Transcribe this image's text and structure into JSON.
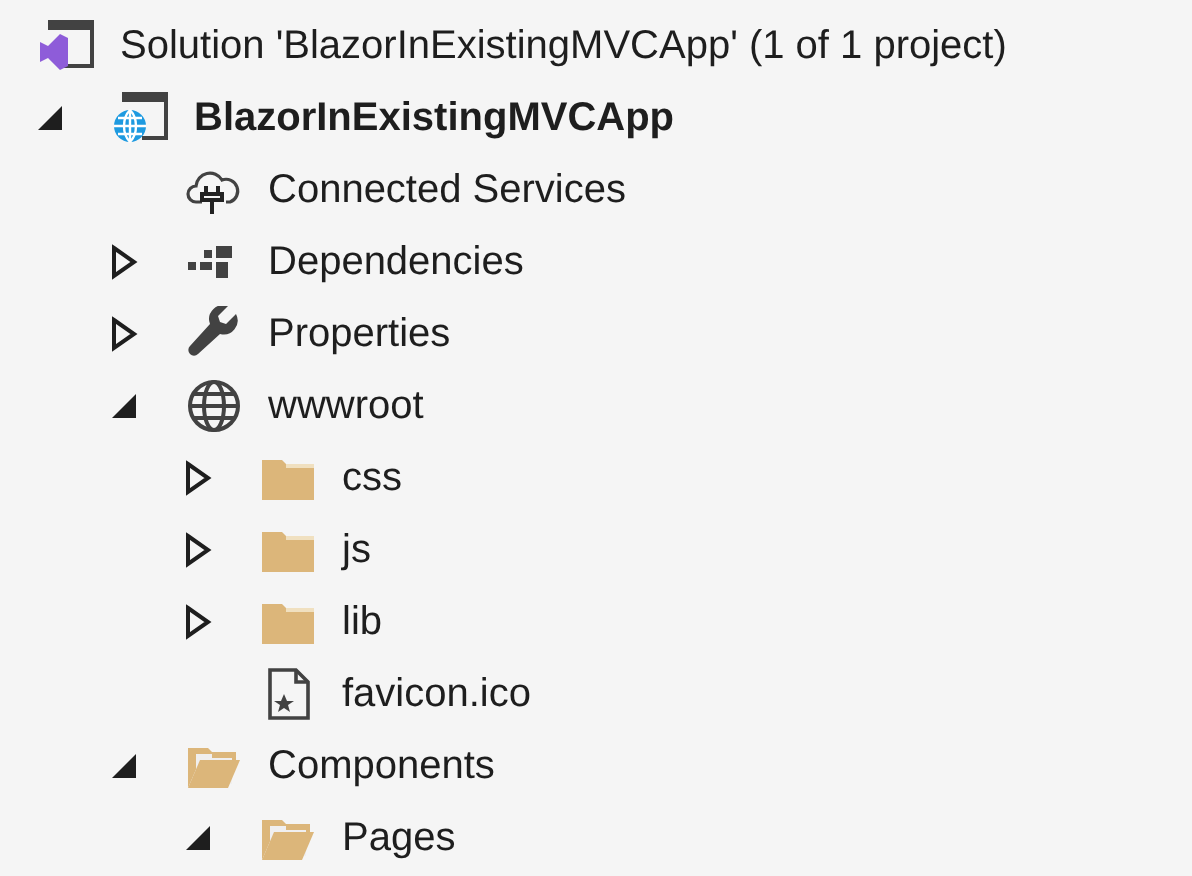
{
  "solution": {
    "label": "Solution 'BlazorInExistingMVCApp' (1 of 1 project)",
    "kind": "solution"
  },
  "tree": [
    {
      "label": "BlazorInExistingMVCApp",
      "kind": "project",
      "expanded": true,
      "bold": true,
      "children": [
        {
          "label": "Connected Services",
          "kind": "cloud"
        },
        {
          "label": "Dependencies",
          "kind": "dependencies",
          "expanded": false
        },
        {
          "label": "Properties",
          "kind": "wrench",
          "expanded": false
        },
        {
          "label": "wwwroot",
          "kind": "globe",
          "expanded": true,
          "children": [
            {
              "label": "css",
              "kind": "folder",
              "expanded": false
            },
            {
              "label": "js",
              "kind": "folder",
              "expanded": false
            },
            {
              "label": "lib",
              "kind": "folder",
              "expanded": false
            },
            {
              "label": "favicon.ico",
              "kind": "file"
            }
          ]
        },
        {
          "label": "Components",
          "kind": "open-folder",
          "expanded": true,
          "children": [
            {
              "label": "Pages",
              "kind": "open-folder",
              "expanded": true
            }
          ]
        }
      ]
    }
  ]
}
